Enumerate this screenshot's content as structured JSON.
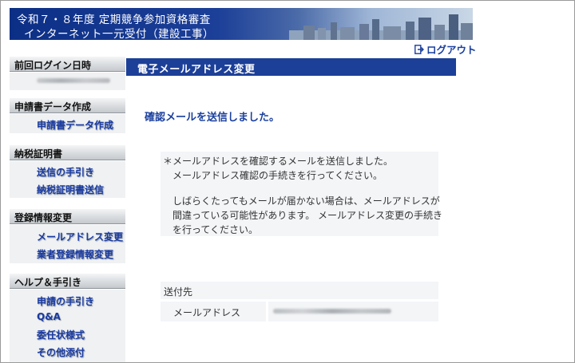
{
  "header": {
    "title_line1": "令和７・８年度 定期競争参加資格審査",
    "title_line2": "インターネット一元受付（建設工事）"
  },
  "logout_label": "ログアウト",
  "sidebar": {
    "last_login": {
      "heading": "前回ログイン日時"
    },
    "application": {
      "heading": "申請書データ作成",
      "items": [
        "申請書データ作成"
      ]
    },
    "tax": {
      "heading": "納税証明書",
      "items": [
        "送信の手引き",
        "納税証明書送信"
      ]
    },
    "registration": {
      "heading": "登録情報変更",
      "items": [
        "メールアドレス変更",
        "業者登録情報変更"
      ]
    },
    "help": {
      "heading": "ヘルプ＆手引き",
      "items": [
        "申請の手引き",
        "Q&A",
        "委任状様式",
        "その他添付"
      ]
    }
  },
  "main": {
    "page_title": "電子メールアドレス変更",
    "confirm_message": "確認メールを送信しました。",
    "notice": {
      "marker": "＊",
      "lines": [
        "メールアドレスを確認するメールを送信しました。",
        "メールアドレス確認の手続きを行ってください。",
        "しばらくたってもメールが届かない場合は、メールアドレスが",
        "間違っている可能性があります。 メールアドレス変更の手続き",
        "を行ってください。"
      ]
    },
    "destination": {
      "title": "送付先",
      "email_label": "メールアドレス"
    }
  },
  "colors": {
    "brand_blue": "#1c3f98",
    "link_blue": "#1a3aa0",
    "panel_bg": "#f3f5f7"
  }
}
